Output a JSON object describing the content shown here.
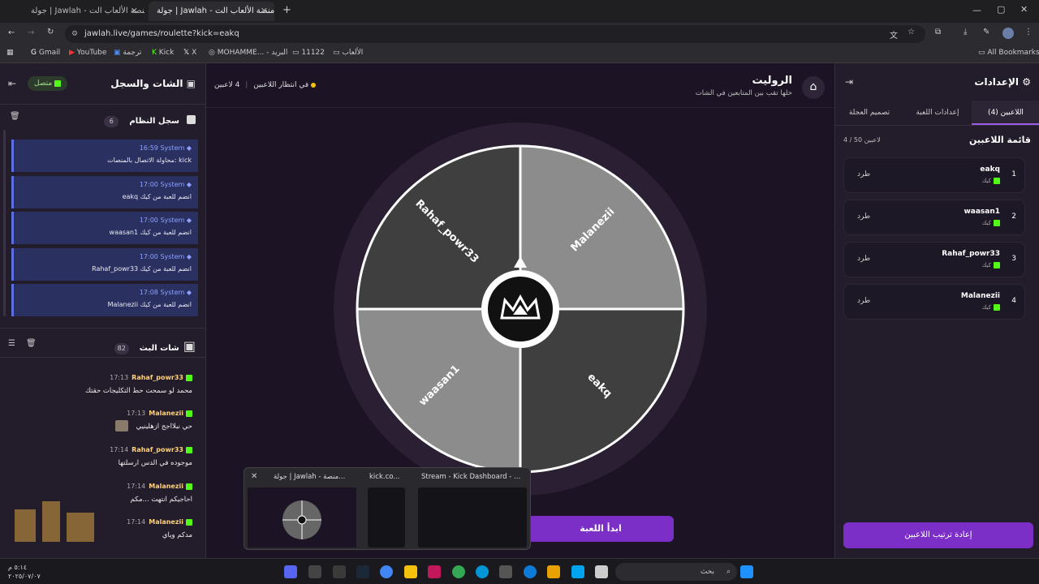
{
  "browser": {
    "tabs": [
      {
        "label": "جولة | Jawlah - منصة الألعاب الت..."
      },
      {
        "label": "جولة | Jawlah - منصة الألعاب الت..."
      }
    ],
    "url": "jawlah.live/games/roulette?kick=eakq",
    "bookmarks": [
      "Gmail",
      "YouTube",
      "ترجمة",
      "Kick",
      "X",
      "MOHAMME... - البريد",
      "11122",
      "الألعاب",
      "All Bookmarks"
    ]
  },
  "left": {
    "title": "الشات والسجل",
    "status": "متصل",
    "system_log": {
      "title": "سجل النظام",
      "count": "6",
      "items": [
        {
          "time": "16:59",
          "sender": "System",
          "text": "محاولة الاتصال بالمنصات: kick"
        },
        {
          "time": "17:00",
          "sender": "System",
          "text": "eakq انضم للعبة من كيك"
        },
        {
          "time": "17:00",
          "sender": "System",
          "text": "waasan1 انضم للعبة من كيك"
        },
        {
          "time": "17:00",
          "sender": "System",
          "text": "Rahaf_powr33 انضم للعبة من كيك"
        },
        {
          "time": "17:08",
          "sender": "System",
          "text": "Malanezii انضم للعبة من كيك"
        }
      ]
    },
    "stream_chat": {
      "title": "شات البث",
      "count": "82",
      "messages": [
        {
          "time": "17:13",
          "user": "Rahaf_powr33",
          "text": "محمد لو سمحت حط التكليجات حقتك"
        },
        {
          "time": "17:13",
          "user": "Malanezii",
          "text": "حي نبلااجج ازهلينيي"
        },
        {
          "time": "17:14",
          "user": "Rahaf_powr33",
          "text": "موجوده في الدس ارسلتها"
        },
        {
          "time": "17:14",
          "user": "Malanezii",
          "text": "احاجيكم انتهت ...مكم"
        },
        {
          "time": "17:14",
          "user": "Malanezii",
          "text": "مدكم وياي"
        }
      ]
    }
  },
  "center": {
    "title": "الروليت",
    "subtitle": "خلها تقب بين المتابعين في الشات",
    "players_count": "4 لاعبين",
    "waiting": "في انتظار اللاعبين",
    "wheel_labels": [
      "Malanezii",
      "eakq",
      "waasan1",
      "Rahaf_powr33"
    ],
    "start_button": "ابدأ اللعبة"
  },
  "right": {
    "title": "الإعدادات",
    "tabs": [
      "اللاعبين (4)",
      "إعدادات اللعبة",
      "تصميم العجلة"
    ],
    "list_title": "قائمة اللاعبين",
    "list_count": "4 / 50 لاعبين",
    "players": [
      {
        "num": "1",
        "name": "eakq",
        "platform": "كيك",
        "action": "طرد"
      },
      {
        "num": "2",
        "name": "waasan1",
        "platform": "كيك",
        "action": "طرد"
      },
      {
        "num": "3",
        "name": "Rahaf_powr33",
        "platform": "كيك",
        "action": "طرد"
      },
      {
        "num": "4",
        "name": "Malanezii",
        "platform": "كيك",
        "action": "طرد"
      }
    ],
    "bottom_button": "إعادة ترتيب اللاعبين"
  },
  "thumbnails": [
    {
      "label": "جولة | Jawlah - منصة..."
    },
    {
      "label": "kick.co..."
    },
    {
      "label": "Stream - Kick Dashboard - ..."
    }
  ],
  "taskbar": {
    "search": "بحث",
    "date": "٢٠٢٥/٠٧/٠٧",
    "time": "٥:١٤ م"
  },
  "colors": {
    "accent": "#7b2fc7",
    "kick_green": "#53fc18",
    "wheel_dark": "#3f3f3f",
    "wheel_light": "#8c8c8c"
  }
}
